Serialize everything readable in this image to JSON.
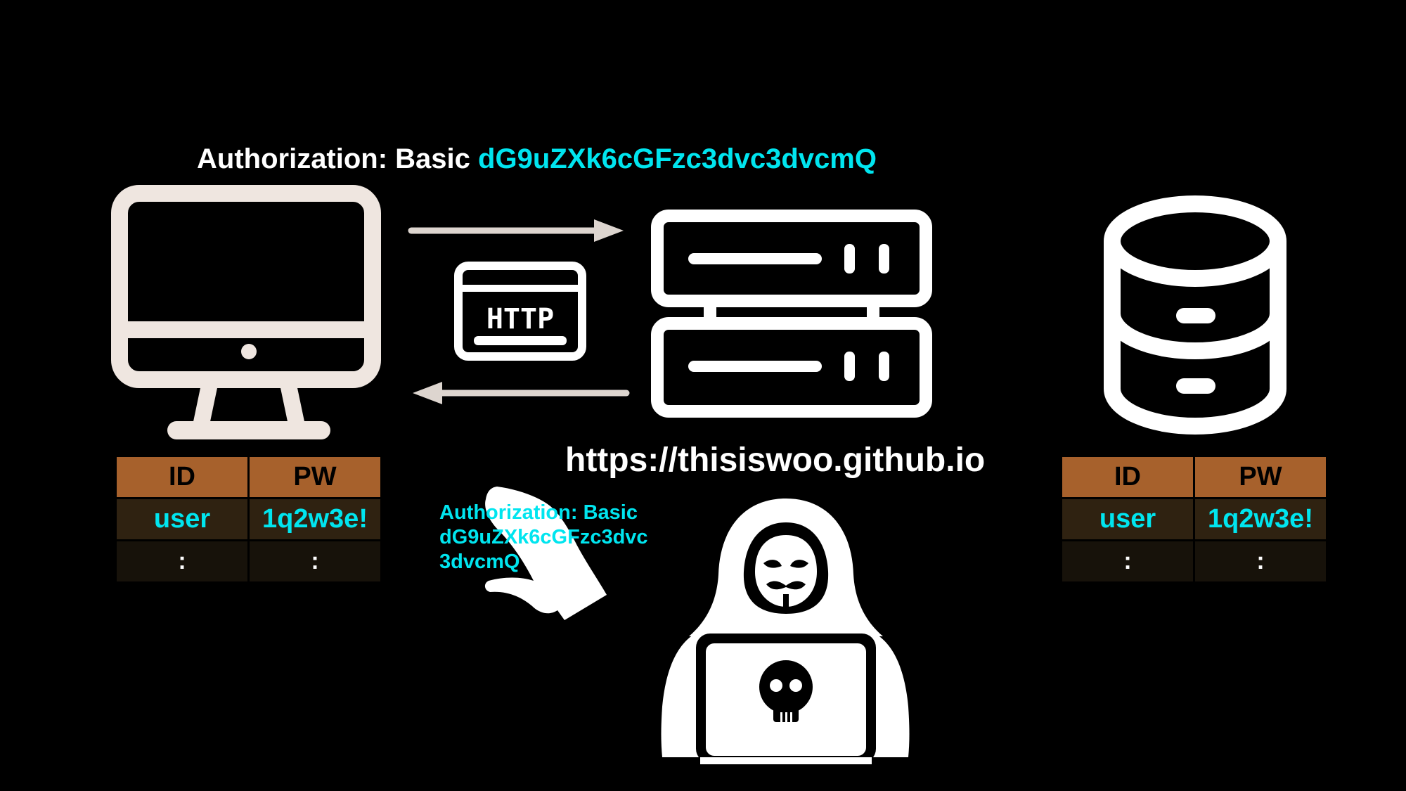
{
  "request_header": {
    "prefix": "Authorization: Basic",
    "token": "dG9uZXk6cGFzc3dvc3dvcmQ"
  },
  "server_url": "https://thisiswoo.github.io",
  "stolen_header": {
    "line1": "Authorization: Basic",
    "line2": "dG9uZXk6cGFzc3dvc",
    "line3": "3dvcmQ"
  },
  "http_badge": "HTTP",
  "client_table": {
    "headers": [
      "ID",
      "PW"
    ],
    "rows": [
      [
        "user",
        "1q2w3e!"
      ],
      [
        ":",
        ":"
      ]
    ]
  },
  "db_table": {
    "headers": [
      "ID",
      "PW"
    ],
    "rows": [
      [
        "user",
        "1q2w3e!"
      ],
      [
        ":",
        ":"
      ]
    ]
  },
  "colors": {
    "background": "#000000",
    "token": "#00e5ef",
    "table_header": "#a7612c",
    "table_row": "#2f2211",
    "table_row_alt": "#17120a",
    "monitor": "#efe6e0",
    "arrow": "#ddd5cf",
    "icons": "#ffffff"
  },
  "icons": [
    "monitor-icon",
    "server-icon",
    "database-icon",
    "http-icon",
    "hacker-icon",
    "grabbing-hand-icon",
    "arrow-right-icon",
    "arrow-left-icon"
  ]
}
